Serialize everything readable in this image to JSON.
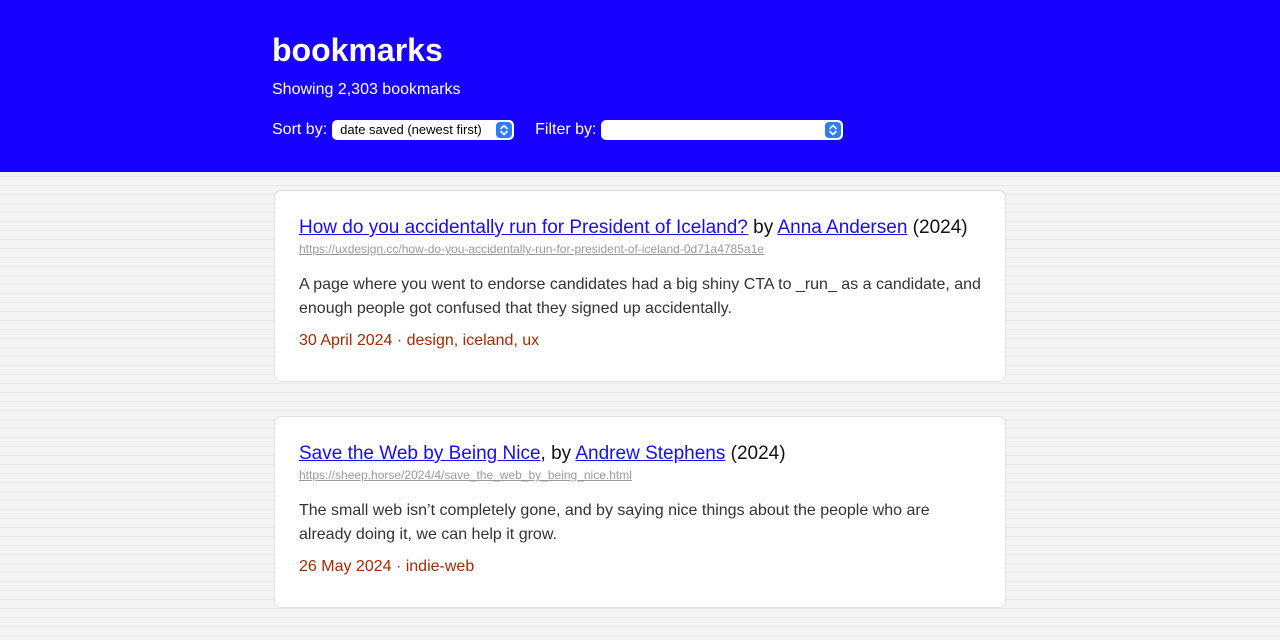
{
  "header": {
    "title": "bookmarks",
    "count": "Showing 2,303 bookmarks",
    "sort_label": "Sort by:",
    "sort_value": "date saved (newest first)",
    "filter_label": "Filter by:",
    "filter_value": ""
  },
  "colors": {
    "header_bg": "#1800ff",
    "link": "#1a0dee",
    "meta": "#a52a00",
    "select_arrow": "#2f7df6"
  },
  "bookmarks": [
    {
      "title": "How do you accidentally run for President of Iceland?",
      "by": " by ",
      "author": "Anna Andersen",
      "year": " (2024)",
      "url": "https://uxdesign.cc/how-do-you-accidentally-run-for-president-of-iceland-0d71a4785a1e",
      "description": "A page where you went to endorse candidates had a big shiny CTA to _run_ as a candidate, and enough people got confused that they signed up accidentally.",
      "meta": "30 April 2024 · design, iceland, ux"
    },
    {
      "title": "Save the Web by Being Nice",
      "by": ", by ",
      "author": "Andrew Stephens",
      "year": " (2024)",
      "url": "https://sheep.horse/2024/4/save_the_web_by_being_nice.html",
      "description": "The small web isn’t completely gone, and by saying nice things about the people who are already doing it, we can help it grow.",
      "meta": "26 May 2024 · indie-web"
    }
  ]
}
